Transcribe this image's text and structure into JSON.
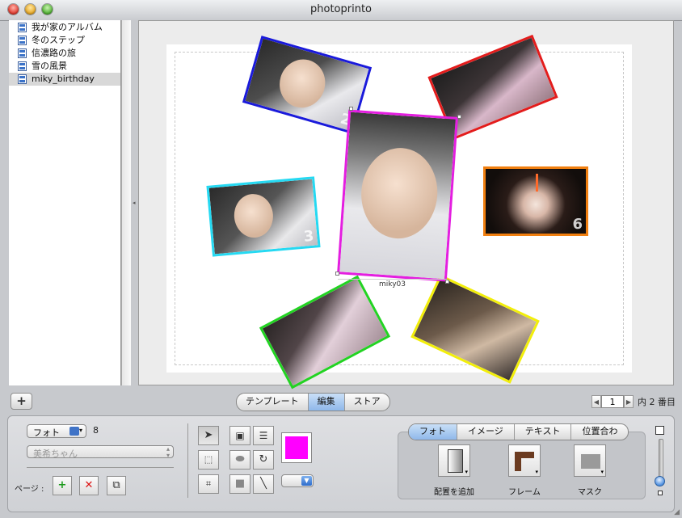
{
  "window": {
    "title": "photoprinto"
  },
  "sidebar": {
    "items": [
      {
        "label": "我が家のアルバム"
      },
      {
        "label": "冬のステップ"
      },
      {
        "label": "信濃路の旅"
      },
      {
        "label": "雪の風景"
      },
      {
        "label": "miky_birthday",
        "selected": true
      }
    ]
  },
  "canvas": {
    "photos": [
      {
        "frame_color": "#1a1adb",
        "number": "2"
      },
      {
        "frame_color": "#e31c1c",
        "number": ""
      },
      {
        "frame_color": "#e41ee0",
        "number": ""
      },
      {
        "frame_color": "#25d9f2",
        "number": "3"
      },
      {
        "frame_color": "#f07f10",
        "number": "6"
      },
      {
        "frame_color": "#22d322",
        "number": ""
      },
      {
        "frame_color": "#f2ee0a",
        "number": ""
      }
    ],
    "selected_caption": "miky03"
  },
  "toolbar": {
    "add_label": "+",
    "mode_tabs": [
      {
        "label": "テンプレート",
        "active": false
      },
      {
        "label": "編集",
        "active": true
      },
      {
        "label": "ストア",
        "active": false
      }
    ],
    "pager": {
      "prev": "◀",
      "page_value": "1",
      "next": "▶",
      "total_text": "内 2 番目"
    }
  },
  "inspector": {
    "type_popup": "フォト",
    "count": "8",
    "name_popup": "美希ちゃん",
    "page_label": "ページ :",
    "page_icons": [
      "page-add-icon",
      "page-delete-icon",
      "page-copy-icon"
    ],
    "tools": [
      "arrow-tool-icon",
      "text-box-tool-icon",
      "text-list-tool-icon",
      "select-tool-icon",
      "ellipse-tool-icon",
      "rotate-tool-icon",
      "crop-tool-icon",
      "rect-tool-icon",
      "line-tool-icon"
    ],
    "color": "#ff00ff",
    "tabs": [
      {
        "label": "フォト",
        "active": true
      },
      {
        "label": "イメージ",
        "active": false
      },
      {
        "label": "テキスト",
        "active": false
      },
      {
        "label": "位置合わ",
        "active": false
      }
    ],
    "actions": [
      {
        "label": "配置を追加",
        "icon": "add-placement-icon"
      },
      {
        "label": "フレーム",
        "icon": "frame-icon"
      },
      {
        "label": "マスク",
        "icon": "mask-icon"
      }
    ]
  }
}
